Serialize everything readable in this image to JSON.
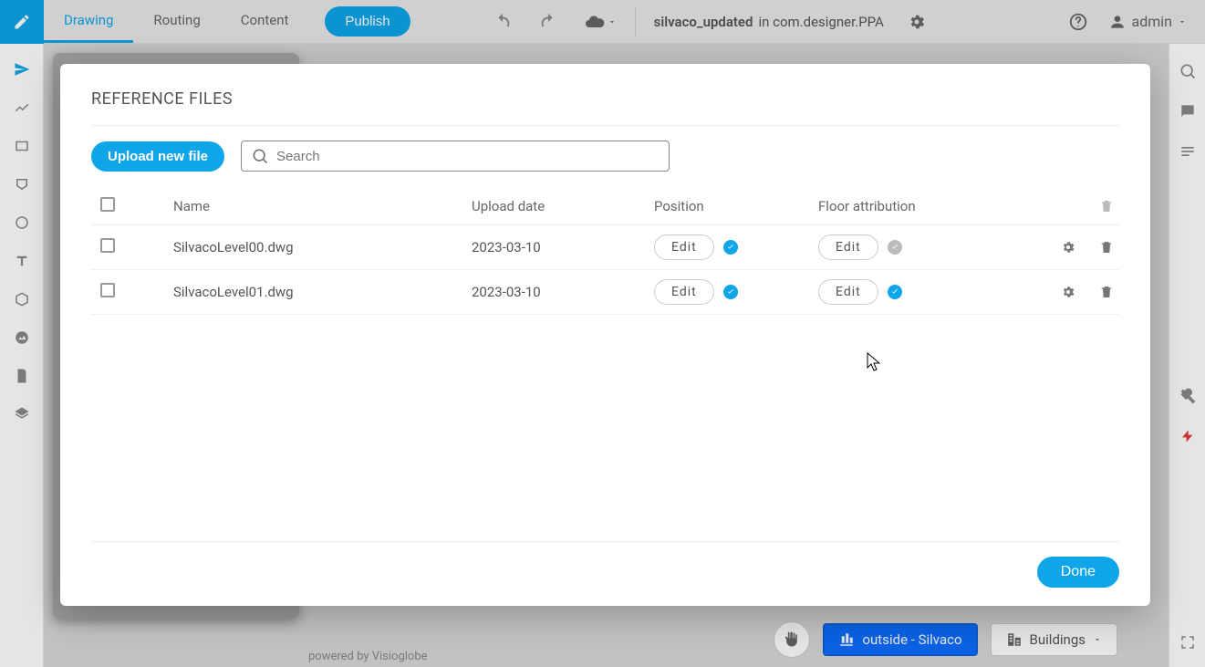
{
  "topbar": {
    "tabs": {
      "drawing": "Drawing",
      "routing": "Routing",
      "content": "Content"
    },
    "publish": "Publish",
    "filename_bold": "silvaco_updated",
    "filename_rest": " in com.designer.PPA",
    "user": "admin"
  },
  "leftpanel": {
    "select": "SELECT"
  },
  "modal": {
    "title": "REFERENCE FILES",
    "upload": "Upload new file",
    "search_placeholder": "Search",
    "columns": {
      "name": "Name",
      "upload_date": "Upload date",
      "position": "Position",
      "floor": "Floor attribution"
    },
    "edit_label": "Edit",
    "done": "Done",
    "rows": [
      {
        "name": "SilvacoLevel00.dwg",
        "date": "2023-03-10",
        "pos_state": "blue",
        "floor_state": "gray"
      },
      {
        "name": "SilvacoLevel01.dwg",
        "date": "2023-03-10",
        "pos_state": "blue",
        "floor_state": "blue"
      }
    ]
  },
  "bottom": {
    "outside": "outside - Silvaco",
    "buildings": "Buildings",
    "powered": "powered by Visioglobe"
  }
}
